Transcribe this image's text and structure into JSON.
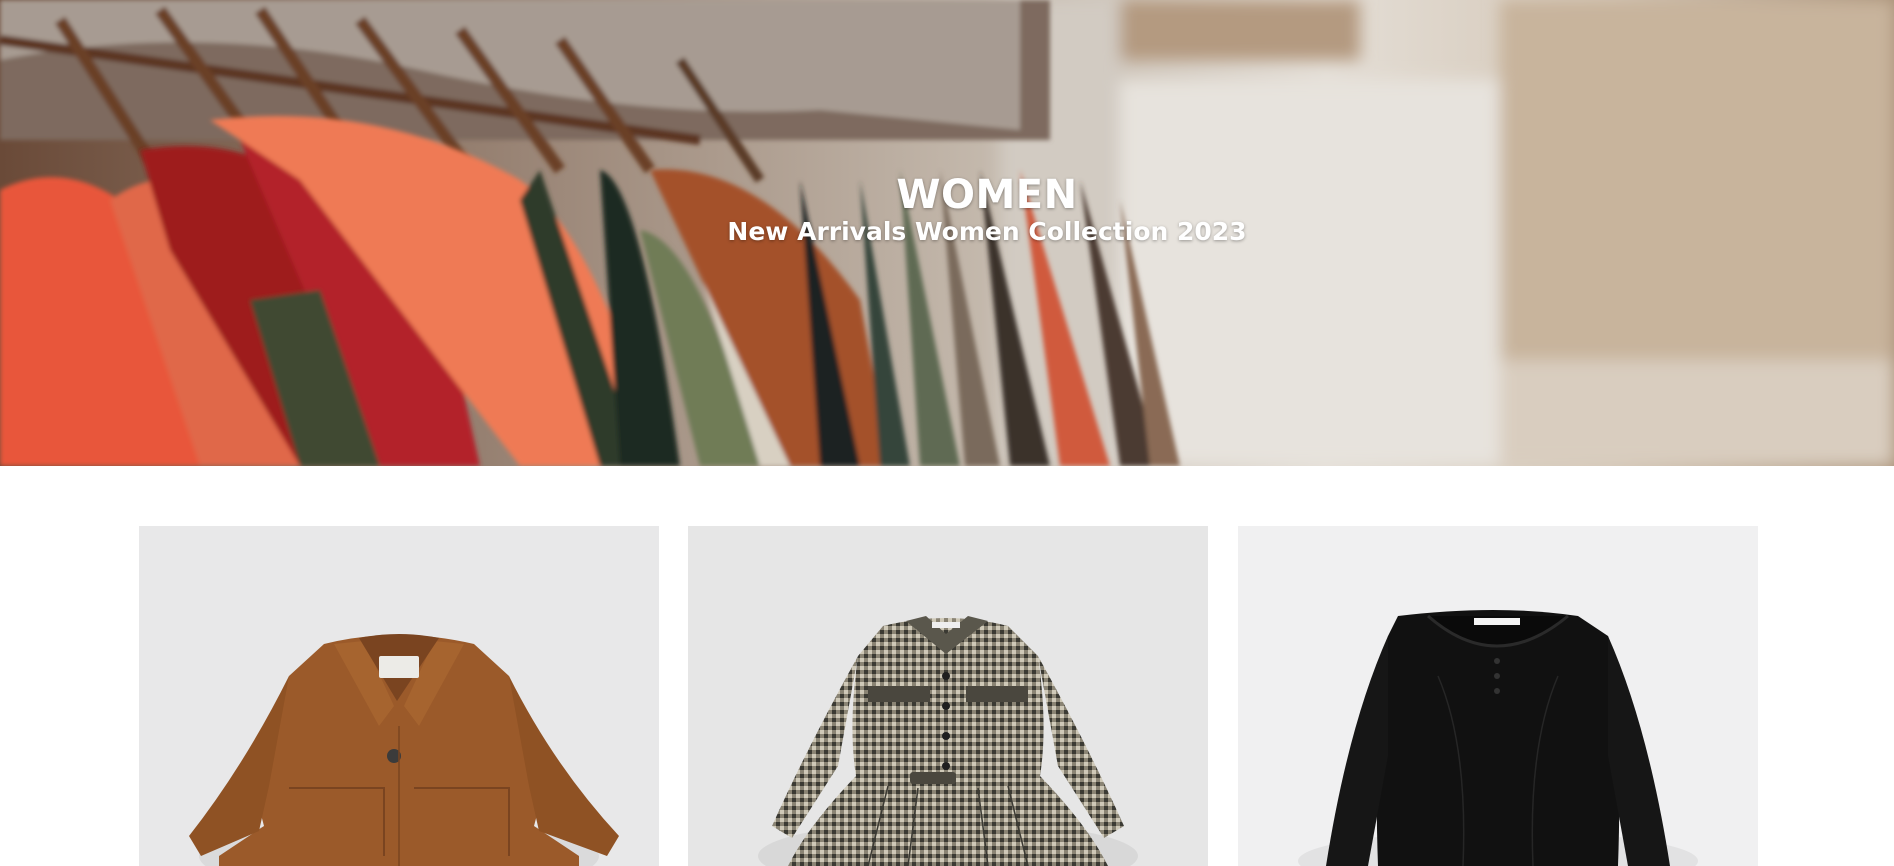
{
  "hero": {
    "title": "WOMEN",
    "subtitle": "New Arrivals Women Collection 2023"
  },
  "products": [
    {
      "image": "brown-wool-coat"
    },
    {
      "image": "gingham-shirt-dress"
    },
    {
      "image": "black-long-sleeve-top"
    }
  ],
  "colors": {
    "background": "#ffffff",
    "hero_text": "#ffffff",
    "card_background": "#e8e8e9"
  }
}
